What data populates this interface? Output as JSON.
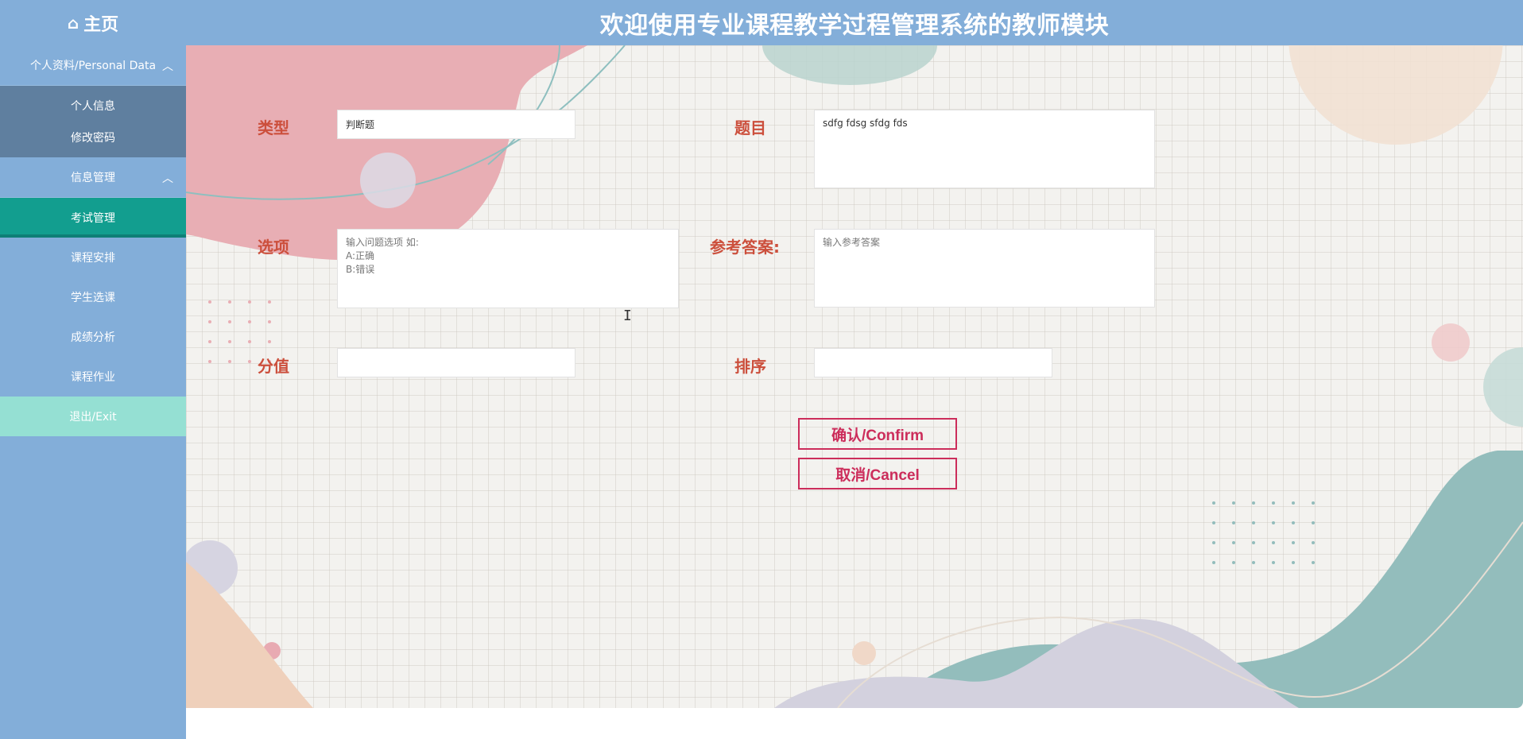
{
  "header": {
    "home_label": "主页",
    "home_icon": "home-icon",
    "title": "欢迎使用专业课程教学过程管理系统的教师模块"
  },
  "sidebar": {
    "group_personal": "个人资料/Personal Data",
    "personal_items": [
      "个人信息",
      "修改密码"
    ],
    "group_info": "信息管理",
    "items": [
      "考试管理",
      "课程安排",
      "学生选课",
      "成绩分析",
      "课程作业"
    ],
    "active_item": "考试管理",
    "exit": "退出/Exit"
  },
  "form": {
    "type_label": "类型",
    "type_value": "判断题",
    "question_label": "题目",
    "question_value": "sdfg fdsg sfdg fds",
    "options_label": "选项",
    "options_placeholder": "输入问题选项 如:\nA:正确\nB:错误",
    "answer_label": "参考答案:",
    "answer_placeholder": "输入参考答案",
    "score_label": "分值",
    "score_value": "",
    "sort_label": "排序",
    "sort_value": ""
  },
  "buttons": {
    "confirm": "确认/Confirm",
    "cancel": "取消/Cancel"
  },
  "colors": {
    "header_bg": "#83aed9",
    "active_nav": "#129e8f",
    "exit_bg": "#95e0d3",
    "label_color": "#cc4f3c",
    "button_color": "#cc2d5b"
  }
}
